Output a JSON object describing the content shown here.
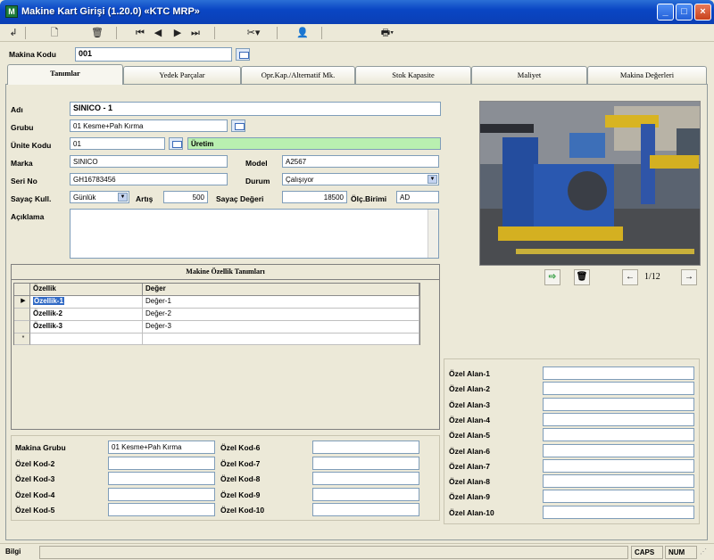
{
  "window": {
    "title": "Makine Kart Girişi (1.20.0) «KTC MRP»",
    "app_icon": "M"
  },
  "toolbar": {
    "icons": [
      "save-icon",
      "new-document-icon",
      "delete-icon",
      "first-record-icon",
      "previous-record-icon",
      "next-record-icon",
      "last-record-icon",
      "tools-icon",
      "user-icon",
      "print-icon"
    ]
  },
  "machine_code": {
    "label": "Makina Kodu",
    "value": "001"
  },
  "tabs": [
    "Tanımlar",
    "Yedek Parçalar",
    "Opr.Kap./Alternatif Mk.",
    "Stok Kapasite",
    "Maliyet",
    "Makina Değerleri"
  ],
  "form": {
    "name_label": "Adı",
    "name_value": "SINICO - 1",
    "group_label": "Grubu",
    "group_value": "01 Kesme+Pah Kırma",
    "unit_label": "Ünite Kodu",
    "unit_value": "01",
    "unit_desc": "Üretim",
    "brand_label": "Marka",
    "brand_value": "SINICO",
    "model_label": "Model",
    "model_value": "A2567",
    "serial_label": "Seri No",
    "serial_value": "GH16783456",
    "status_label": "Durum",
    "status_value": "Çalışıyor",
    "counter_usage_label": "Sayaç Kull.",
    "counter_usage_value": "Günlük",
    "increase_label": "Artış",
    "increase_value": "500",
    "counter_value_label": "Sayaç Değeri",
    "counter_value": "18500",
    "unit_measure_label": "Ölç.Birimi",
    "unit_measure_value": "AD",
    "description_label": "Açıklama"
  },
  "properties": {
    "title": "Makine Özellik Tanımları",
    "columns": [
      "Özellik",
      "Değer"
    ],
    "rows": [
      [
        "Özellik-1",
        "Değer-1"
      ],
      [
        "Özellik-2",
        "Değer-2"
      ],
      [
        "Özellik-3",
        "Değer-3"
      ]
    ],
    "new_row_marker": "*"
  },
  "photo_nav": {
    "page": "1/12"
  },
  "special_fields": [
    "Özel Alan-1",
    "Özel Alan-2",
    "Özel Alan-3",
    "Özel Alan-4",
    "Özel Alan-5",
    "Özel Alan-6",
    "Özel Alan-7",
    "Özel Alan-8",
    "Özel Alan-9",
    "Özel Alan-10"
  ],
  "codes_left": [
    {
      "label": "Makina Grubu",
      "value": "01 Kesme+Pah Kırma"
    },
    {
      "label": "Özel Kod-2",
      "value": ""
    },
    {
      "label": "Özel Kod-3",
      "value": ""
    },
    {
      "label": "Özel Kod-4",
      "value": ""
    },
    {
      "label": "Özel Kod-5",
      "value": ""
    }
  ],
  "codes_right": [
    {
      "label": "Özel Kod-6",
      "value": ""
    },
    {
      "label": "Özel Kod-7",
      "value": ""
    },
    {
      "label": "Özel Kod-8",
      "value": ""
    },
    {
      "label": "Özel Kod-9",
      "value": ""
    },
    {
      "label": "Özel Kod-10",
      "value": ""
    }
  ],
  "status": {
    "left": "Bilgi",
    "caps": "CAPS",
    "num": "NUM"
  },
  "colors": {
    "titlebar": "#0a46c4",
    "unit_desc_bg": "#b9f0b0",
    "selection": "#316ac5"
  }
}
